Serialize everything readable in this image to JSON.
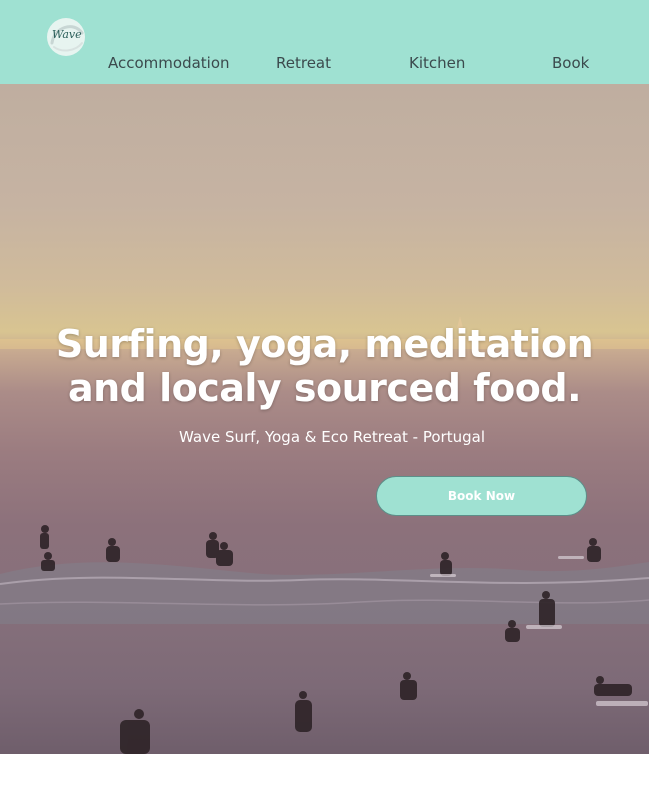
{
  "header": {
    "logo_text": "Wave",
    "nav": [
      {
        "label": "Accommodation"
      },
      {
        "label": "Retreat"
      },
      {
        "label": "Kitchen"
      },
      {
        "label": "Book"
      }
    ]
  },
  "hero": {
    "headline_line1": "Surfing, yoga, meditation",
    "headline_line2": "and localy sourced food.",
    "subtitle": "Wave Surf, Yoga & Eco Retreat - Portugal",
    "cta_label": "Book Now"
  },
  "colors": {
    "header_bg": "#9fe1d2",
    "nav_text": "#3b4a4d",
    "button_bg": "#9fe1d2"
  }
}
